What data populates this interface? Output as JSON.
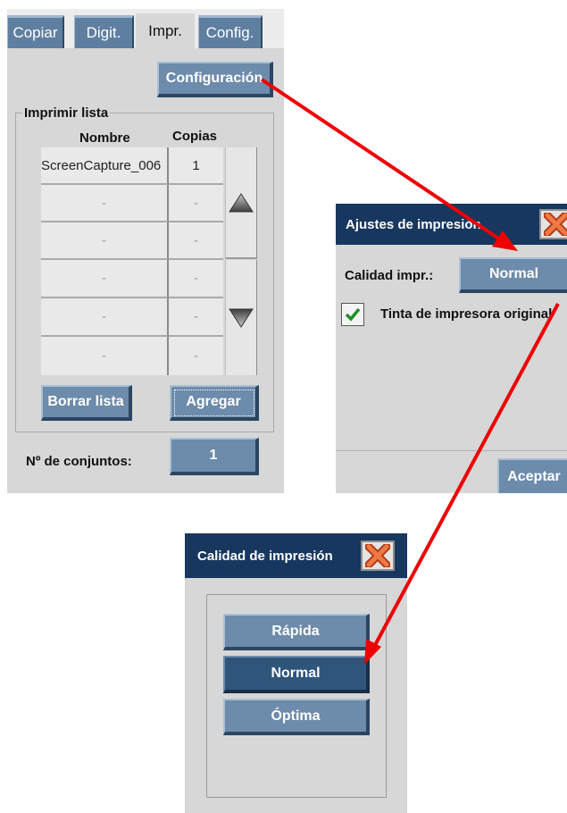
{
  "panel_main": {
    "tabs": [
      {
        "label": "Copiar",
        "active": false
      },
      {
        "label": "Digit.",
        "active": false
      },
      {
        "label": "Impr.",
        "active": true
      },
      {
        "label": "Config.",
        "active": false
      }
    ],
    "config_button": "Configuración",
    "print_list": {
      "legend": "Imprimir lista",
      "col_name": "Nombre",
      "col_copies": "Copias",
      "rows": [
        {
          "name": "ScreenCapture_006",
          "copies": "1"
        },
        {
          "name": "-",
          "copies": "-"
        },
        {
          "name": "-",
          "copies": "-"
        },
        {
          "name": "-",
          "copies": "-"
        },
        {
          "name": "-",
          "copies": "-"
        },
        {
          "name": "-",
          "copies": "-"
        }
      ],
      "clear_button": "Borrar lista",
      "add_button": "Agregar"
    },
    "sets_label": "Nº de conjuntos:",
    "sets_value": "1"
  },
  "panel_settings": {
    "title": "Ajustes de impresión",
    "quality_label": "Calidad impr.:",
    "quality_value": "Normal",
    "original_ink_label": "Tinta de impresora original",
    "original_ink_checked": true,
    "ok_button": "Aceptar"
  },
  "panel_quality": {
    "title": "Calidad de impresión",
    "options": [
      {
        "label": "Rápida",
        "selected": false
      },
      {
        "label": "Normal",
        "selected": true
      },
      {
        "label": "Óptima",
        "selected": false
      }
    ]
  },
  "icons": {
    "close": "close-x-icon",
    "scroll_up": "triangle-up-icon",
    "scroll_down": "triangle-down-icon",
    "check": "checkmark-icon"
  },
  "colors": {
    "button": "#6d8bab",
    "button_selected": "#2f557b",
    "titlebar": "#17375e",
    "panel_bg": "#d7d7d7",
    "arrow": "#ee0000",
    "close_x": "#e8572b"
  }
}
